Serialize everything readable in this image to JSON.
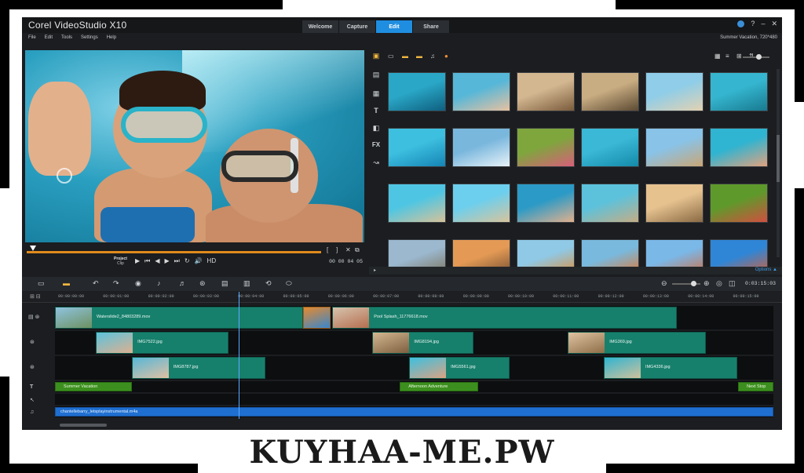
{
  "app": {
    "title": "Corel VideoStudio X10",
    "tabs": [
      {
        "label": "Welcome",
        "active": false
      },
      {
        "label": "Capture",
        "active": false
      },
      {
        "label": "Edit",
        "active": true
      },
      {
        "label": "Share",
        "active": false
      }
    ],
    "window_buttons": [
      "?",
      "–",
      "✕"
    ]
  },
  "menu": {
    "items": [
      "File",
      "Edit",
      "Tools",
      "Settings",
      "Help"
    ],
    "project_info": "Summer Vacation, 720*480"
  },
  "player": {
    "project_label": "Project",
    "clip_label": "Clip",
    "timecode": "00 00 04 05",
    "controls": [
      "▶",
      "⏮",
      "◀",
      "▶",
      "⏭",
      "↻",
      "🔊",
      "HD"
    ],
    "mark_in": "[",
    "mark_out": "]"
  },
  "library": {
    "tool_icons": [
      "media-icon",
      "instant-project-icon",
      "transition-icon",
      "title-icon",
      "graphic-icon",
      "fx-icon",
      "path-icon"
    ],
    "fx_label": "FX",
    "title_label": "T",
    "options_label": "Options ▲",
    "thumbnails": [
      {
        "name": "kids-snorkel",
        "color_a": "#2aa7c7",
        "color_b": "#0f5f7f"
      },
      {
        "name": "girl-pool",
        "color_a": "#56b7d8",
        "color_b": "#e8c1a0"
      },
      {
        "name": "beach-lie",
        "color_a": "#d3b791",
        "color_b": "#7a5b3b"
      },
      {
        "name": "beach-kids",
        "color_a": "#c9ad82",
        "color_b": "#5c4a33"
      },
      {
        "name": "cartwheel",
        "color_a": "#8fcde8",
        "color_b": "#e2d2b2"
      },
      {
        "name": "underwater-pair",
        "color_a": "#35b5cf",
        "color_b": "#187a8f"
      },
      {
        "name": "pool-float",
        "color_a": "#3dc0e0",
        "color_b": "#1584b5"
      },
      {
        "name": "splash",
        "color_a": "#7ab7dd",
        "color_b": "#e8f2f8"
      },
      {
        "name": "garden-girl",
        "color_a": "#7ea63d",
        "color_b": "#d85f7a"
      },
      {
        "name": "diving",
        "color_a": "#3ab8d6",
        "color_b": "#138aa8"
      },
      {
        "name": "jumping-sand",
        "color_a": "#89c3e8",
        "color_b": "#c9a676"
      },
      {
        "name": "snorkel-kid",
        "color_a": "#2fb4d1",
        "color_b": "#e1a27e"
      },
      {
        "name": "girl-sea",
        "color_a": "#4ec6e3",
        "color_b": "#d7c299"
      },
      {
        "name": "beach-run",
        "color_a": "#6ccfee",
        "color_b": "#d8c49c"
      },
      {
        "name": "pool-boys",
        "color_a": "#2b9ac6",
        "color_b": "#e2b08d"
      },
      {
        "name": "shore-kids",
        "color_a": "#5cc2dc",
        "color_b": "#c4ad85"
      },
      {
        "name": "sunset-jump",
        "color_a": "#e6c28f",
        "color_b": "#8a6a44"
      },
      {
        "name": "grass-kid",
        "color_a": "#5e9a2b",
        "color_b": "#d14f3f"
      },
      {
        "name": "palms",
        "color_a": "#9bb8cf",
        "color_b": "#7a6e55"
      },
      {
        "name": "sunset-walk",
        "color_a": "#e49a55",
        "color_b": "#6b4a2e"
      },
      {
        "name": "kayak",
        "color_a": "#8fc9e6",
        "color_b": "#e38b2f"
      },
      {
        "name": "kayak-two",
        "color_a": "#79b9dd",
        "color_b": "#e6732a"
      },
      {
        "name": "sky-sail",
        "color_a": "#7ab8e8",
        "color_b": "#d46a3b"
      },
      {
        "name": "kite",
        "color_a": "#2f86d6",
        "color_b": "#e35a2a"
      }
    ]
  },
  "timeline": {
    "timecode": "0:03:15:03",
    "ruler_labels": [
      "00:00:00:00",
      "00:00:01:00",
      "00:00:02:00",
      "00:00:03:00",
      "00:00:04:00",
      "00:00:05:00",
      "00:00:06:00",
      "00:00:07:00",
      "00:00:08:00",
      "00:00:09:00",
      "00:00:10:00",
      "00:00:11:00",
      "00:00:12:00",
      "00:00:13:00",
      "00:00:14:00",
      "00:00:15:00"
    ],
    "video_clips": [
      {
        "label": "Waterslide2_84803289.mov",
        "start": 0.0,
        "end": 0.345,
        "thumb_a": "#8fc3e0",
        "thumb_b": "#6b8f5a"
      },
      {
        "label": "",
        "start": 0.345,
        "end": 0.384,
        "thumb_a": "#e48a2f",
        "thumb_b": "#2f86d6"
      },
      {
        "label": "Pool Splash_11776618.mov",
        "start": 0.386,
        "end": 0.866,
        "thumb_a": "#d7c3ae",
        "thumb_b": "#b36a4a"
      }
    ],
    "overlay1_clips": [
      {
        "label": "IMG7522.jpg",
        "start": 0.057,
        "end": 0.242,
        "thumb_a": "#5cc2dc",
        "thumb_b": "#e2b08d"
      },
      {
        "label": "IMG8194.jpg",
        "start": 0.442,
        "end": 0.582,
        "thumb_a": "#d3b791",
        "thumb_b": "#7a5b3b"
      },
      {
        "label": "IMG369.jpg",
        "start": 0.714,
        "end": 0.906,
        "thumb_a": "#e0c3a2",
        "thumb_b": "#8a6a44"
      }
    ],
    "overlay2_clips": [
      {
        "label": "IMG8787.jpg",
        "start": 0.107,
        "end": 0.293,
        "thumb_a": "#56b7d8",
        "thumb_b": "#e8c1a0"
      },
      {
        "label": "IMG5561.jpg",
        "start": 0.493,
        "end": 0.633,
        "thumb_a": "#3dc0e0",
        "thumb_b": "#e1a27e"
      },
      {
        "label": "IMG4336.jpg",
        "start": 0.764,
        "end": 0.95,
        "thumb_a": "#2fb4d1",
        "thumb_b": "#d7c299"
      }
    ],
    "title_clips": [
      {
        "label": "Summer Vacation",
        "start": 0.0,
        "end": 0.107
      },
      {
        "label": "Afternoon Adventure",
        "start": 0.48,
        "end": 0.589
      },
      {
        "label": "Next Stop",
        "start": 0.951,
        "end": 1.0
      }
    ],
    "audio_clip": {
      "label": "chantellebarry_letsplayinstrumental.m4a",
      "start": 0.0,
      "end": 1.0
    }
  },
  "watermark": {
    "text": "KUYHAA-ME.PW"
  },
  "colors": {
    "accent": "#1f8ee0",
    "video_clip": "#17806c",
    "title_clip": "#3c8f1e",
    "audio_clip": "#1f6fd0",
    "scrub_track": "#e08a1c"
  }
}
